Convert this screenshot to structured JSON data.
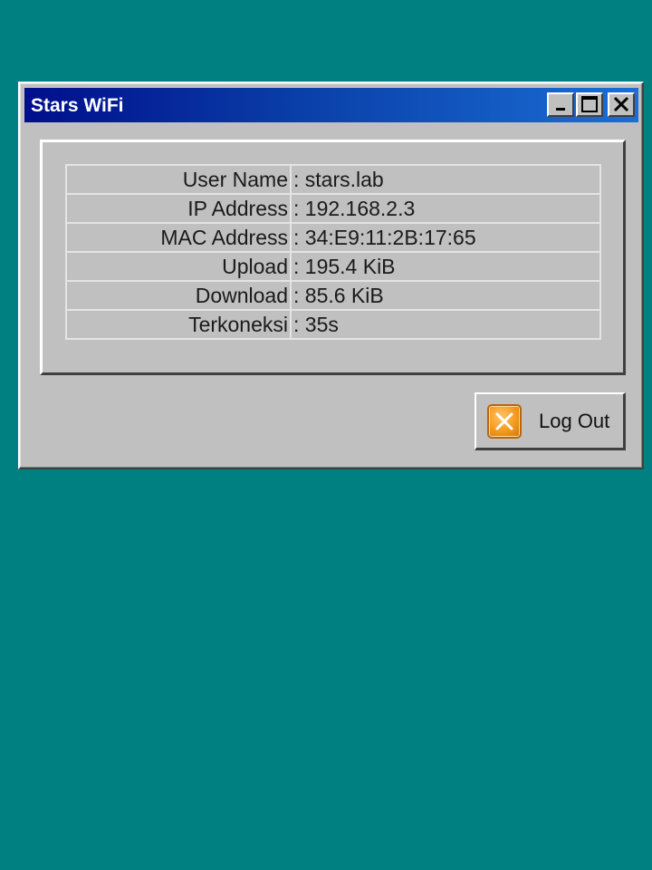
{
  "window": {
    "title": "Stars WiFi",
    "controls": {
      "minimize_icon": "minimize-icon",
      "maximize_icon": "maximize-icon",
      "close_icon": "close-icon"
    }
  },
  "info": {
    "rows": [
      {
        "label": "User Name",
        "value": ": stars.lab"
      },
      {
        "label": "IP Address",
        "value": ": 192.168.2.3"
      },
      {
        "label": "MAC Address",
        "value": ": 34:E9:11:2B:17:65"
      },
      {
        "label": "Upload",
        "value": ": 195.4 KiB"
      },
      {
        "label": "Download",
        "value": ": 85.6 KiB"
      },
      {
        "label": "Terkoneksi",
        "value": ": 35s"
      }
    ]
  },
  "logout": {
    "label": "Log Out",
    "icon": "logout-x-icon",
    "icon_color": "#f39a1c"
  },
  "colors": {
    "desktop": "#008080",
    "titlebar_start": "#000e8c",
    "titlebar_end": "#1a6ed6",
    "window_face": "#c0c0c0"
  }
}
